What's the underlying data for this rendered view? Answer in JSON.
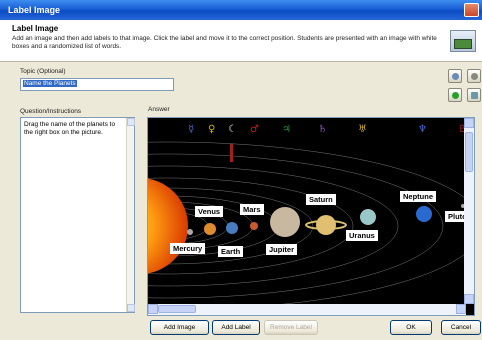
{
  "window": {
    "title": "Label Image"
  },
  "header": {
    "title": "Label Image",
    "description": "Add an image and then add labels to that image. Click the label and move it to the correct position. Students are presented with an image with white boxes and a randomized list of words."
  },
  "topic": {
    "label": "Topic (Optional)",
    "value": "Name the Planets"
  },
  "question": {
    "label": "Question/Instructions",
    "text": "Drag the name of the planets to the right box on the picture."
  },
  "answer": {
    "label": "Answer",
    "planet_labels": [
      "Venus",
      "Mars",
      "Saturn",
      "Neptune",
      "Pluto",
      "Mercury",
      "Earth",
      "Jupiter",
      "Uranus"
    ],
    "symbols": [
      "☿",
      "♀",
      "☾",
      "♂",
      "♃",
      "♄",
      "♅",
      "♆",
      "♇"
    ]
  },
  "buttons": {
    "add_image": "Add Image",
    "add_label": "Add Label",
    "remove_label": "Remove Label",
    "ok": "OK",
    "cancel": "Cancel"
  }
}
